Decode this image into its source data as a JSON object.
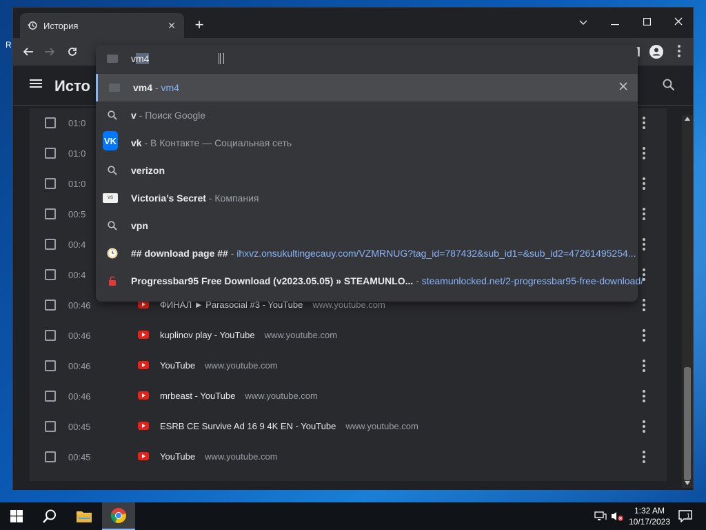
{
  "desktop": {
    "edge_letter": "R"
  },
  "tab": {
    "title": "История",
    "close": "✕"
  },
  "new_tab_glyph": "+",
  "window_controls": {
    "dropdown": "⌄",
    "minimize": "—",
    "maximize": "☐",
    "close": "✕"
  },
  "page": {
    "title": "Исто"
  },
  "omnibox": {
    "typed_prefix": "v",
    "selected_completion": "m4"
  },
  "suggestions": [
    {
      "icon": "folder-icon",
      "main": "vm4",
      "sep": " - ",
      "desc": "",
      "url": "vm4",
      "type": "bookmark"
    },
    {
      "icon": "search-icon",
      "main": "v",
      "sep": " - ",
      "desc": "Поиск Google",
      "url": "",
      "type": "search"
    },
    {
      "icon": "vk-icon",
      "main": "vk",
      "sep": " - ",
      "desc": "В Контакте — Социальная сеть",
      "url": "",
      "type": "entity"
    },
    {
      "icon": "search-icon",
      "main": "verizon",
      "sep": "",
      "desc": "",
      "url": "",
      "type": "search"
    },
    {
      "icon": "victorias-secret-icon",
      "main": "Victoria’s Secret",
      "sep": " - ",
      "desc": "Компания",
      "url": "",
      "type": "entity"
    },
    {
      "icon": "search-icon",
      "main": "vpn",
      "sep": "",
      "desc": "",
      "url": "",
      "type": "search"
    },
    {
      "icon": "clock-icon",
      "main": "## download page ##",
      "sep": " - ",
      "desc": "",
      "url": "ihxvz.onsukultingecauy.com/VZMRNUG?tag_id=787432&sub_id1=&sub_id2=47261495254...",
      "type": "history"
    },
    {
      "icon": "lock-icon",
      "main": "Progressbar95 Free Download (v2023.05.05) » STEAMUNLO...",
      "sep": " - ",
      "desc": "",
      "url": "steamunlocked.net/2-progressbar95-free-download/",
      "type": "history"
    }
  ],
  "history_rows": [
    {
      "time": "01:0",
      "title": "",
      "domain": ""
    },
    {
      "time": "01:0",
      "title": "",
      "domain": ""
    },
    {
      "time": "01:0",
      "title": "",
      "domain": ""
    },
    {
      "time": "00:5",
      "title": "",
      "domain": ""
    },
    {
      "time": "00:4",
      "title": "",
      "domain": ""
    },
    {
      "time": "00:4",
      "title": "",
      "domain": ""
    },
    {
      "time": "00:46",
      "title": "ФИНАЛ ► Parasocial #3 - YouTube",
      "domain": "www.youtube.com"
    },
    {
      "time": "00:46",
      "title": "kuplinov play - YouTube",
      "domain": "www.youtube.com"
    },
    {
      "time": "00:46",
      "title": "YouTube",
      "domain": "www.youtube.com"
    },
    {
      "time": "00:46",
      "title": "mrbeast - YouTube",
      "domain": "www.youtube.com"
    },
    {
      "time": "00:45",
      "title": "ESRB CE Survive Ad 16 9 4K EN - YouTube",
      "domain": "www.youtube.com"
    },
    {
      "time": "00:45",
      "title": "YouTube",
      "domain": "www.youtube.com"
    }
  ],
  "tray": {
    "time": "1:32 AM",
    "date": "10/17/2023",
    "notifications": "1"
  },
  "colors": {
    "accent": "#8ab4f8",
    "youtube_red": "#e62117",
    "vk_blue": "#0077ff"
  }
}
